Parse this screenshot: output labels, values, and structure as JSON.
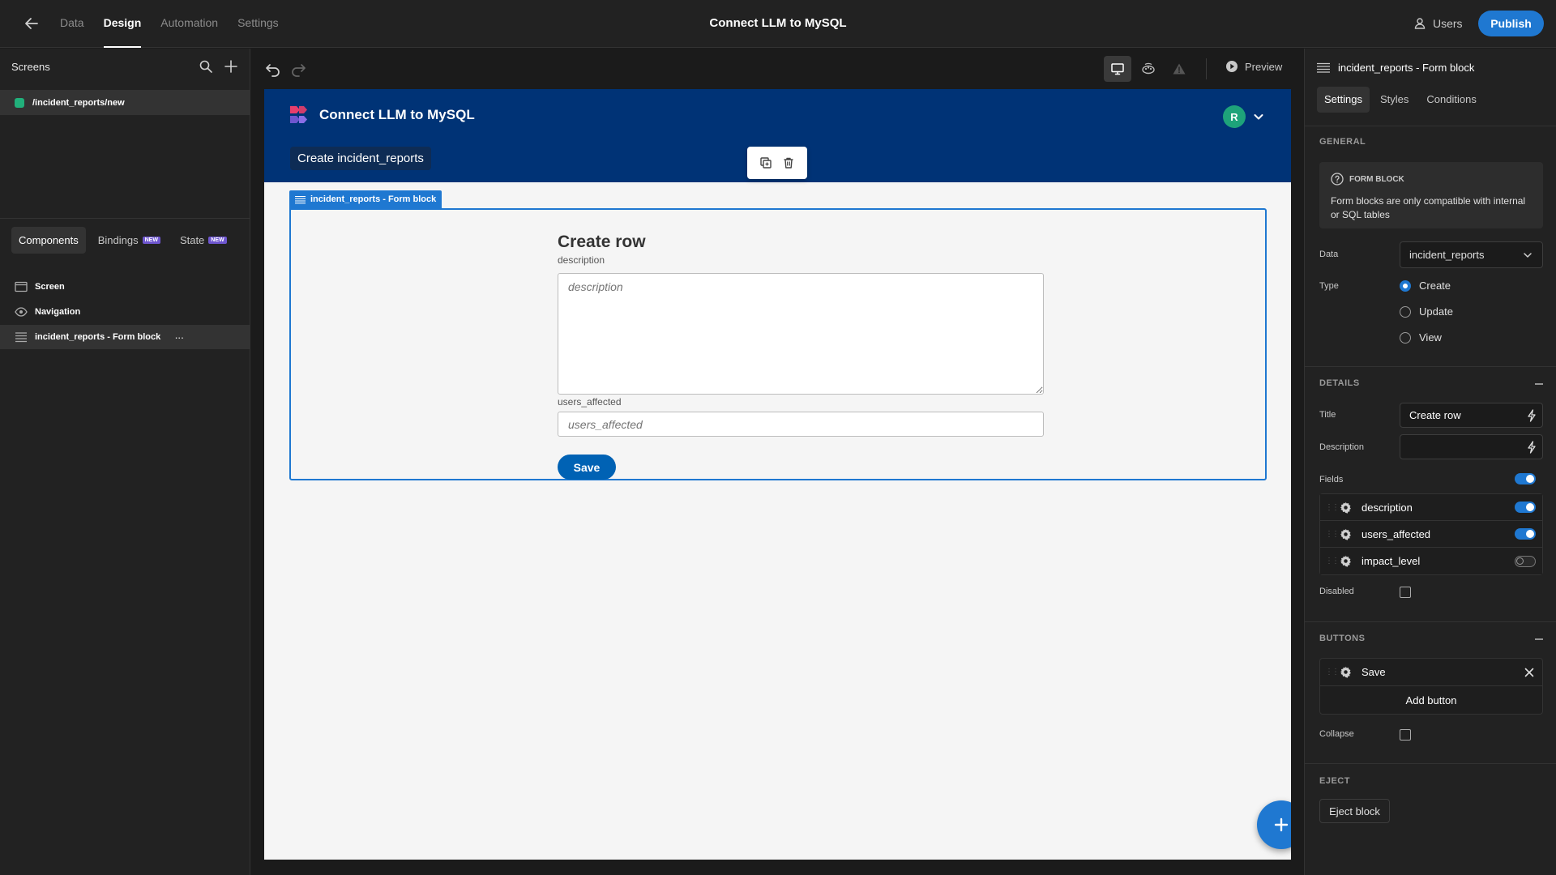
{
  "topbar": {
    "nav": [
      "Data",
      "Design",
      "Automation",
      "Settings"
    ],
    "active_nav": "Design",
    "app_title": "Connect LLM to MySQL",
    "users_label": "Users",
    "publish_label": "Publish"
  },
  "left": {
    "screens_title": "Screens",
    "screen_route": "/incident_reports/new",
    "tabs": [
      "Components",
      "Bindings",
      "State"
    ],
    "new_badge": "NEW",
    "tree": [
      "Screen",
      "Navigation",
      "incident_reports - Form block"
    ],
    "tree_more": "···"
  },
  "toolbar": {
    "preview_label": "Preview"
  },
  "preview": {
    "app_name": "Connect LLM to MySQL",
    "avatar_initial": "R",
    "nav_link": "Create incident_reports",
    "block_tag": "incident_reports - Form block",
    "form_title": "Create row",
    "fields": [
      {
        "label": "description",
        "placeholder": "description"
      },
      {
        "label": "users_affected",
        "placeholder": "users_affected"
      }
    ],
    "save_label": "Save"
  },
  "right": {
    "header": "incident_reports - Form block",
    "tabs": [
      "Settings",
      "Styles",
      "Conditions"
    ],
    "general": {
      "title": "GENERAL",
      "info_head": "FORM BLOCK",
      "info_text": "Form blocks are only compatible with internal or SQL tables",
      "data_label": "Data",
      "data_value": "incident_reports",
      "type_label": "Type",
      "type_options": [
        "Create",
        "Update",
        "View"
      ],
      "type_selected": "Create"
    },
    "details": {
      "title": "DETAILS",
      "title_label": "Title",
      "title_value": "Create row",
      "description_label": "Description",
      "description_value": "",
      "fields_label": "Fields",
      "fields_enabled": true,
      "field_items": [
        {
          "name": "description",
          "enabled": true
        },
        {
          "name": "users_affected",
          "enabled": true
        },
        {
          "name": "impact_level",
          "enabled": false
        }
      ],
      "disabled_label": "Disabled",
      "disabled_checked": false
    },
    "buttons": {
      "title": "BUTTONS",
      "items": [
        "Save"
      ],
      "add_label": "Add button",
      "collapse_label": "Collapse",
      "collapse_checked": false
    },
    "eject": {
      "title": "EJECT",
      "button_label": "Eject block"
    }
  },
  "colors": {
    "accent": "#1f78d1",
    "app_header": "#003376",
    "screen_dot": "#21b07b",
    "avatar": "#1ea37a",
    "badge": "#6e56cf"
  }
}
